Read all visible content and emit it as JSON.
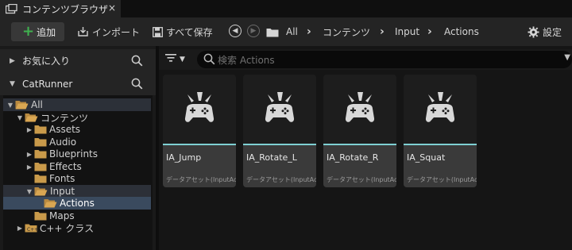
{
  "tab": {
    "title": "コンテンツブラウザ",
    "close": "×"
  },
  "toolbar": {
    "add_label": "追加",
    "import_label": "インポート",
    "save_all_label": "すべて保存",
    "settings_label": "設定"
  },
  "breadcrumb": [
    "All",
    "コンテンツ",
    "Input",
    "Actions"
  ],
  "sidebar": {
    "favorites_label": "お気に入り",
    "project_label": "CatRunner"
  },
  "tree": [
    {
      "label": "All",
      "indent": 0,
      "arrow": "down",
      "open": true,
      "state": "highlight"
    },
    {
      "label": "コンテンツ",
      "indent": 1,
      "arrow": "down",
      "open": true,
      "state": ""
    },
    {
      "label": "Assets",
      "indent": 2,
      "arrow": "right",
      "open": false,
      "state": ""
    },
    {
      "label": "Audio",
      "indent": 2,
      "arrow": "",
      "open": false,
      "state": ""
    },
    {
      "label": "Blueprints",
      "indent": 2,
      "arrow": "right",
      "open": false,
      "state": ""
    },
    {
      "label": "Effects",
      "indent": 2,
      "arrow": "right",
      "open": false,
      "state": ""
    },
    {
      "label": "Fonts",
      "indent": 2,
      "arrow": "",
      "open": false,
      "state": ""
    },
    {
      "label": "Input",
      "indent": 2,
      "arrow": "down",
      "open": true,
      "state": "highlight"
    },
    {
      "label": "Actions",
      "indent": 3,
      "arrow": "",
      "open": true,
      "state": "selected"
    },
    {
      "label": "Maps",
      "indent": 2,
      "arrow": "",
      "open": false,
      "state": ""
    },
    {
      "label": "C++ クラス",
      "indent": 1,
      "arrow": "right",
      "open": false,
      "state": "",
      "cpp": true
    }
  ],
  "search": {
    "placeholder": "検索 Actions"
  },
  "assets": [
    {
      "name": "IA_Jump",
      "type": "データアセット(InputAction)"
    },
    {
      "name": "IA_Rotate_L",
      "type": "データアセット(InputAction)"
    },
    {
      "name": "IA_Rotate_R",
      "type": "データアセット(InputAction)"
    },
    {
      "name": "IA_Squat",
      "type": "データアセット(InputAction)"
    }
  ],
  "colors": {
    "accent": "#7fd0d3",
    "add_plus": "#3fb24f",
    "folder": "#c99a4a",
    "selected_row": "#3a4a5e"
  },
  "icons": {
    "tab": "content-browser-icon",
    "add": "plus-icon",
    "import": "import-icon",
    "save": "save-icon",
    "history_back": "back-arrow-icon",
    "history_forward": "forward-arrow-icon",
    "folder": "folder-icon",
    "settings": "gear-icon",
    "search": "search-icon",
    "filter": "filter-icon",
    "asset_thumb": "gamepad-icon"
  }
}
